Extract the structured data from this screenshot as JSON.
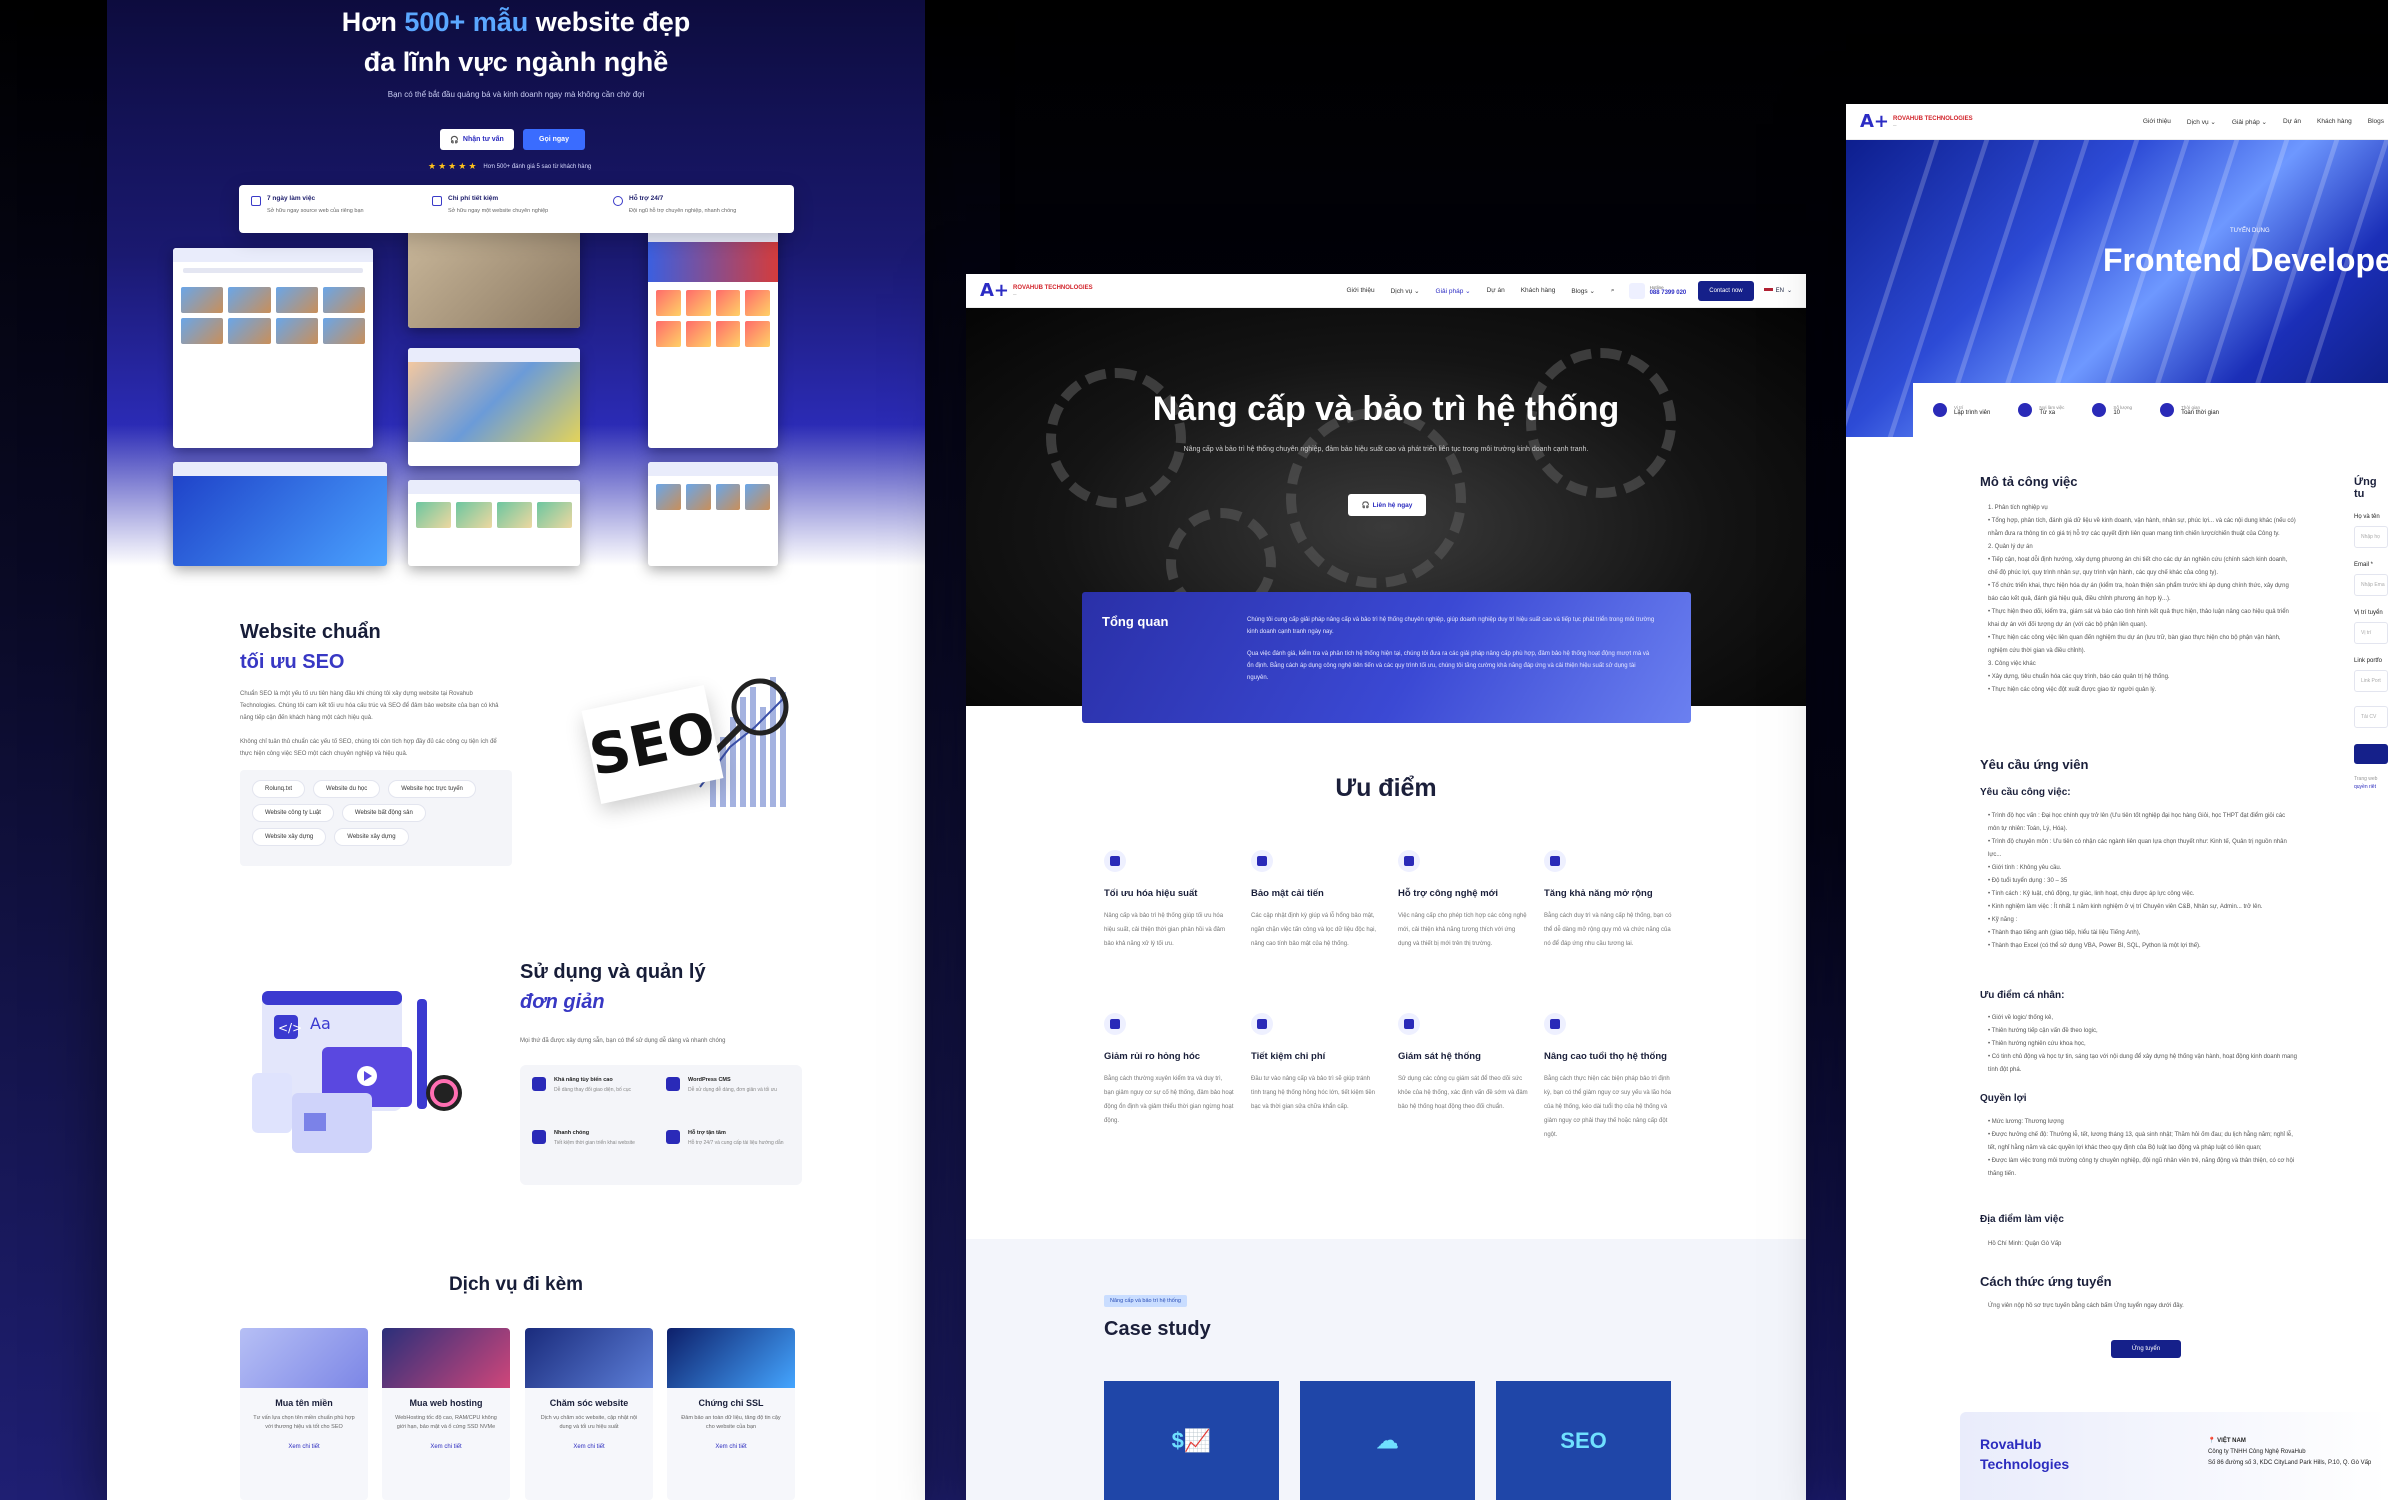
{
  "panel1": {
    "hero": {
      "title_prefix": "Hơn ",
      "title_highlight": "500+ mẫu",
      "title_suffix": " website đẹp",
      "title_line2": "đa lĩnh vực ngành nghề",
      "subtitle": "Bạn có thể bắt đầu quảng bá và kinh doanh ngay mà không cần chờ đợi",
      "btn_consult": "Nhận tư vấn",
      "btn_call": "Gọi ngay",
      "rating_text": "Hơn 500+ đánh giá 5 sao từ khách hàng",
      "features": [
        {
          "title": "7 ngày làm việc",
          "desc": "Sở hữu ngay source web của riêng bạn"
        },
        {
          "title": "Chi phí tiết kiệm",
          "desc": "Sở hữu ngay một website chuyên nghiệp"
        },
        {
          "title": "Hỗ trợ 24/7",
          "desc": "Đội ngũ hỗ trợ chuyên nghiệp, nhanh chóng"
        }
      ]
    },
    "seo": {
      "title_line1": "Website chuẩn",
      "title_line2": "tối ưu SEO",
      "para1": "Chuẩn SEO là một yếu tố ưu tiên hàng đầu khi chúng tôi xây dựng website tại Rovahub Technologies. Chúng tôi cam kết tối ưu hóa cấu trúc và SEO để đảm bảo website của bạn có khả năng tiếp cận đến khách hàng một cách hiệu quả.",
      "para2": "Không chỉ tuân thủ chuẩn các yếu tố SEO, chúng tôi còn tích hợp đầy đủ các công cụ tiện ích để thực hiện công việc SEO một cách chuyên nghiệp và hiệu quả.",
      "tags": [
        "Rolunq.txt",
        "Website du học",
        "Website học trực tuyến",
        "Website công ty Luật",
        "Website bất động sản",
        "Website xây dựng",
        "Website xây dựng"
      ],
      "image_text": "SEO"
    },
    "manage": {
      "title_line1": "Sử dụng và quản lý",
      "title_line2": "đơn giản",
      "desc": "Mọi thứ đã được xây dựng sẵn, bạn có thể sử dụng dễ dàng và nhanh chóng",
      "items": [
        {
          "title": "Khả năng tùy biến cao",
          "desc": "Dễ dàng thay đổi giao diện, bố cục"
        },
        {
          "title": "WordPress CMS",
          "desc": "Dễ sử dụng dễ dàng, đơn giản và tối ưu"
        },
        {
          "title": "Nhanh chóng",
          "desc": "Tiết kiệm thời gian triển khai website"
        },
        {
          "title": "Hỗ trợ tận tâm",
          "desc": "Hỗ trợ 24/7 và cung cấp tài liệu hướng dẫn"
        }
      ]
    },
    "services": {
      "title": "Dịch vụ đi kèm",
      "items": [
        {
          "title": "Mua tên miền",
          "desc": "Tư vấn lựa chọn tên miền chuẩn phù hợp với thương hiệu và tốt cho SEO",
          "link": "Xem chi tiết"
        },
        {
          "title": "Mua web hosting",
          "desc": "WebHosting tốc độ cao, RAM/CPU không giới hạn, bảo mật và ổ cứng SSD NVMe",
          "link": "Xem chi tiết"
        },
        {
          "title": "Chăm sóc website",
          "desc": "Dịch vụ chăm sóc website, cập nhật nội dung và tối ưu hiệu suất",
          "link": "Xem chi tiết"
        },
        {
          "title": "Chứng chỉ SSL",
          "desc": "Đảm bảo an toàn dữ liệu, tăng độ tin cậy cho website của bạn",
          "link": "Xem chi tiết"
        }
      ]
    }
  },
  "panel2": {
    "nav": {
      "brand": "ROVAHUB TECHNOLOGIES",
      "links": [
        "Giới thiệu",
        "Dịch vụ ⌄",
        "Giải pháp ⌄",
        "Dự án",
        "Khách hàng",
        "Blogs ⌄"
      ],
      "hotline_label": "Hotline",
      "hotline": "088 7399 020",
      "contact": "Contact now",
      "lang": "EN"
    },
    "hero": {
      "title": "Nâng cấp và bảo trì hệ thống",
      "subtitle": "Nâng cấp và bảo trì hệ thống chuyên nghiệp, đảm bảo hiệu suất cao và phát triển liên tục trong môi trường kinh doanh cạnh tranh.",
      "button": "Liên hệ ngay"
    },
    "overview": {
      "title": "Tổng quan",
      "p1": "Chúng tôi cung cấp giải pháp nâng cấp và bảo trì hệ thống chuyên nghiệp, giúp doanh nghiệp duy trì hiệu suất cao và tiếp tục phát triển trong môi trường kinh doanh cạnh tranh ngày nay.",
      "p2": "Qua việc đánh giá, kiểm tra và phân tích hệ thống hiện tại, chúng tôi đưa ra các giải pháp nâng cấp phù hợp, đảm bảo hệ thống hoạt động mượt mà và ổn định. Bằng cách áp dụng công nghệ tiên tiến và các quy trình tối ưu, chúng tôi tăng cường khả năng đáp ứng và cải thiện hiệu suất sử dụng tài nguyên."
    },
    "advantages": {
      "title": "Ưu điểm",
      "items": [
        {
          "title": "Tối ưu hóa hiệu suất",
          "desc": "Nâng cấp và bảo trì hệ thống giúp tối ưu hóa hiệu suất, cải thiện thời gian phản hồi và đảm bảo khả năng xử lý tối ưu."
        },
        {
          "title": "Bảo mật cải tiến",
          "desc": "Các cập nhật định kỳ giúp vá lỗ hổng bảo mật, ngăn chặn việc tấn công và lọc dữ liệu độc hại, nâng cao tính bảo mật của hệ thống."
        },
        {
          "title": "Hỗ trợ công nghệ mới",
          "desc": "Việc nâng cấp cho phép tích hợp các công nghệ mới, cải thiện khả năng tương thích với ứng dụng và thiết bị mới trên thị trường."
        },
        {
          "title": "Tăng khả năng mở rộng",
          "desc": "Bằng cách duy trì và nâng cấp hệ thống, bạn có thể dễ dàng mở rộng quy mô và chức năng của nó để đáp ứng nhu cầu tương lai."
        },
        {
          "title": "Giảm rủi ro hỏng hóc",
          "desc": "Bằng cách thường xuyên kiểm tra và duy trì, bạn giảm nguy cơ sự cố hệ thống, đảm bảo hoạt động ổn định và giảm thiểu thời gian ngừng hoạt động."
        },
        {
          "title": "Tiết kiệm chi phí",
          "desc": "Đầu tư vào nâng cấp và bảo trì sẽ giúp tránh tình trạng hệ thống hỏng hóc lớn, tiết kiệm tiền bạc và thời gian sửa chữa khẩn cấp."
        },
        {
          "title": "Giám sát hệ thống",
          "desc": "Sử dụng các công cụ giám sát để theo dõi sức khỏe của hệ thống, xác định vấn đề sớm và đảm bảo hệ thống hoạt động theo đối chuẩn."
        },
        {
          "title": "Nâng cao tuổi thọ hệ thống",
          "desc": "Bằng cách thực hiện các biện pháp bảo trì định kỳ, bạn có thể giảm nguy cơ suy yếu và lão hóa của hệ thống, kéo dài tuổi thọ của hệ thống và giảm nguy cơ phải thay thế hoặc nâng cấp đột ngột."
        }
      ]
    },
    "case_study": {
      "badge": "Nâng cấp và bảo trì hệ thống",
      "title": "Case study",
      "cards": [
        "$📈",
        "☁",
        "SEO"
      ]
    }
  },
  "panel3": {
    "nav": {
      "brand": "ROVAHUB TECHNOLOGIES",
      "links": [
        "Giới thiệu",
        "Dịch vụ ⌄",
        "Giải pháp ⌄",
        "Dự án",
        "Khách hàng",
        "Blogs"
      ]
    },
    "hero": {
      "tag": "TUYỂN DỤNG",
      "title": "Frontend Develope"
    },
    "info": [
      {
        "label": "Vị trí",
        "value": "Lập trình viên"
      },
      {
        "label": "Nơi làm việc",
        "value": "Từ xa"
      },
      {
        "label": "Số lượng",
        "value": "10"
      },
      {
        "label": "Thời gian",
        "value": "Toàn thời gian"
      }
    ],
    "desc": {
      "title": "Mô tả công việc",
      "lines": [
        "1. Phân tích nghiệp vụ",
        "• Tổng hợp, phân tích, đánh giá dữ liệu về kinh doanh, vận hành, nhân sự, phúc lợi... và các nội dung khác (nếu có) nhằm đưa ra thông tin có giá trị hỗ trợ các quyết định liên quan mang tính chiến lược/chiến thuật của Công ty.",
        "2. Quản lý dự án",
        "• Tiếp cận, hoạt dỗi định hướng, xây dựng phương án chi tiết cho các dự án nghiên cứu (chính sách kinh doanh, chế độ phúc lợi, quy trình nhân sự, quy trình vận hành, các quy chế khác của công ty).",
        "• Tổ chức triển khai, thực hiện hóa dự án (kiểm tra, hoàn thiện sản phẩm trước khi áp dụng chính thức, xây dựng báo cáo kết quả, đánh giá hiệu quả, điều chỉnh phương án hợp lý...).",
        "• Thực hiện theo dõi, kiểm tra, giám sát và báo cáo tình hình kết quả thực hiện, thảo luận nâng cao hiệu quả triển khai dự án với đối tượng dự án (với các bộ phận liên quan).",
        "• Thực hiện các công việc liên quan đến nghiệm thu dự án (lưu trữ, bàn giao thực hiện cho bộ phận vận hành, nghiệm cứu thời gian và điều chỉnh).",
        "3. Công việc khác",
        "• Xây dựng, tiêu chuẩn hóa các quy trình, báo cáo quản trị hệ thống.",
        "• Thực hiện các công việc đột xuất được giao từ người quản lý."
      ]
    },
    "req": {
      "title": "Yêu cầu ứng viên",
      "sub": "Yêu cầu công việc:",
      "lines": [
        "• Trình độ học vấn : Đại học chính quy trở lên (Ưu tiên tốt nghiệp đại học hàng Giỏi, học THPT đạt điểm giỏi các môn tự nhiên: Toán, Lý, Hóa).",
        "• Trình độ chuyên môn : Ưu tiên có nhận các ngành liên quan lựa chọn thuyết như: Kinh tế, Quản trị nguồn nhân lực...",
        "• Giới tính : Không yêu cầu.",
        "• Độ tuổi tuyển dụng : 30 – 35",
        "• Tính cách : Kỷ luật, chủ động, tự giác, linh hoạt, chịu được áp lực công việc.",
        "• Kinh nghiệm làm việc : Ít nhất 1 năm kinh nghiệm ở vị trí Chuyên viên C&B, Nhân sự, Admin... trở lên.",
        "• Kỹ năng :",
        "  • Thành thạo tiếng anh (giao tiếp, hiểu tài liệu Tiếng Anh),",
        "  • Thành thạo Excel (có thể sử dụng VBA, Power BI, SQL, Python là một lợi thế)."
      ]
    },
    "plus": {
      "title": "Ưu điểm cá nhân:",
      "lines": [
        "• Giới về logic/ thống kê,",
        "• Thiên hướng tiếp cận vấn đề theo logic,",
        "• Thiên hướng nghiên cứu khoa học,",
        "• Có tinh chủ động và học tự tin, sáng tạo với nội dung để xây dựng hệ thống vận hành, hoạt động kinh doanh mang tính đột phá."
      ]
    },
    "benefit": {
      "title": "Quyền lợi",
      "lines": [
        "• Mức lương: Thương lượng",
        "• Được hưởng chế độ: Thưởng lễ, tết, lương tháng 13, quà sinh nhật; Thăm hỏi ốm đau; du lịch hằng năm; nghỉ lễ, tết, nghỉ hằng năm và các quyền lợi khác theo quy định của Bộ luật lao động và pháp luật có liên quan;",
        "• Được làm việc trong môi trường công ty chuyên nghiệp, đội ngũ nhân viên trẻ, năng động và thân thiện, có cơ hội thăng tiến."
      ]
    },
    "location": {
      "title": "Địa điểm làm việc",
      "value": "Hồ Chí Minh: Quận Gò Vấp"
    },
    "howto": {
      "title": "Cách thức ứng tuyển",
      "desc": "Ứng viên nộp hồ sơ trực tuyến bằng cách bấm Ứng tuyển ngay dưới đây.",
      "button": "Ứng tuyển"
    },
    "form": {
      "title": "Ứng tu",
      "fields": [
        {
          "label": "Họ và tên",
          "placeholder": "Nhập họ"
        },
        {
          "label": "Email *",
          "placeholder": "Nhập Ema"
        },
        {
          "label": "Vị trí tuyển",
          "placeholder": "Vị trí"
        },
        {
          "label": "Link portfo",
          "placeholder": "Link Port"
        },
        {
          "label": "",
          "placeholder": "Tải CV"
        }
      ],
      "note": "Trang web",
      "link": "quyền riêt"
    },
    "footer": {
      "brand_l1": "RovaHub",
      "brand_l2": "Technologies",
      "country": "VIỆT NAM",
      "company": "Công ty TNHH Công Nghệ RovaHub",
      "address": "Số 86 đường số 3, KDC CityLand Park Hills, P.10, Q. Gò Vấp"
    }
  }
}
